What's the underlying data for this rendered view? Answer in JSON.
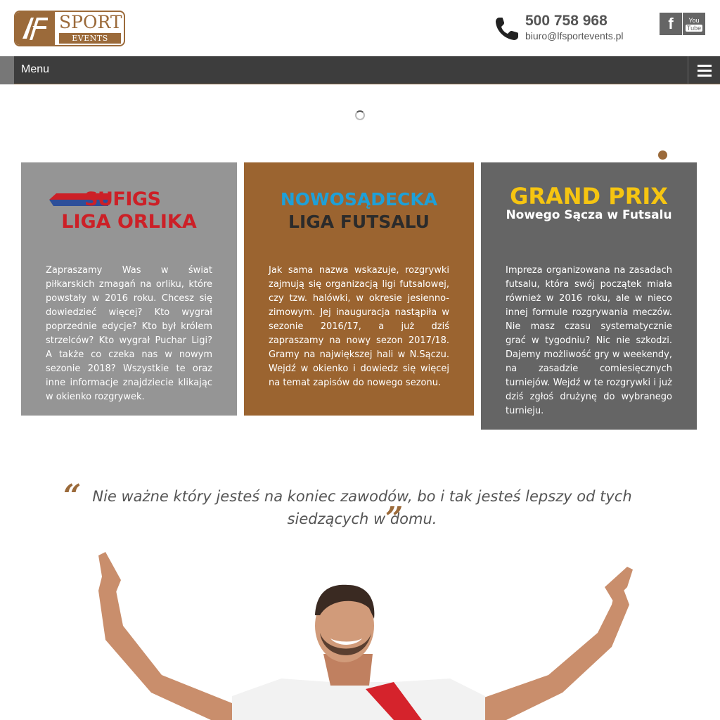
{
  "header": {
    "logo": {
      "sport": "SPORT",
      "events": "EVENTS"
    },
    "phone": "500 758 968",
    "email": "biuro@lfsportevents.pl",
    "social": {
      "facebook": "f",
      "youtube_top": "You",
      "youtube_bottom": "Tube"
    }
  },
  "nav": {
    "menu_label": "Menu"
  },
  "cards": [
    {
      "logo_top": "SUFIGS",
      "logo_bottom": "LIGA ORLIKA",
      "text": "Zapraszamy Was w świat piłkarskich zmagań na orliku, które powstały w 2016 roku. Chcesz się dowiedzieć więcej? Kto wygrał poprzednie edycje? Kto był królem strzelców? Kto wygrał Puchar Ligi? A także co czeka nas w nowym sezonie 2018? Wszystkie te oraz inne informacje znajdziecie klikając w okienko rozgrywek."
    },
    {
      "logo_top": "NOWOSĄDECKA",
      "logo_bottom": "LIGA FUTSALU",
      "text": "Jak sama nazwa wskazuje, rozgrywki zajmują się organizacją ligi futsalowej, czy tzw. halówki, w okresie jesienno-zimowym. Jej inauguracja nastąpiła w sezonie 2016/17, a już dziś zapraszamy na nowy sezon 2017/18. Gramy na największej hali w N.Sączu. Wejdź w okienko i dowiedz się więcej na temat zapisów do nowego sezonu."
    },
    {
      "logo_top": "GRAND PRIX",
      "logo_bottom": "Nowego Sącza w Futsalu",
      "text": "Impreza organizowana na zasadach futsalu, która swój początek miała również w 2016 roku, ale w nieco innej formule rozgrywania meczów. Nie masz czasu systematycznie grać w tygodniu? Nic nie szkodzi. Dajemy możliwość gry w weekendy, na zasadzie comiesięcznych turniejów. Wejdź w te rozgrywki i już dziś zgłoś drużynę do wybranego turnieju."
    }
  ],
  "quote": {
    "text": "Nie ważne który jesteś na koniec zawodów, bo i tak jesteś lepszy od tych siedzących w domu.",
    "open_mark": "“",
    "close_mark": "”"
  },
  "colors": {
    "brand_brown": "#9b6a3a",
    "nav_bg": "#3d3d3d",
    "card1_bg": "#959595",
    "card2_bg": "#9b6430",
    "card3_bg": "#656565"
  }
}
